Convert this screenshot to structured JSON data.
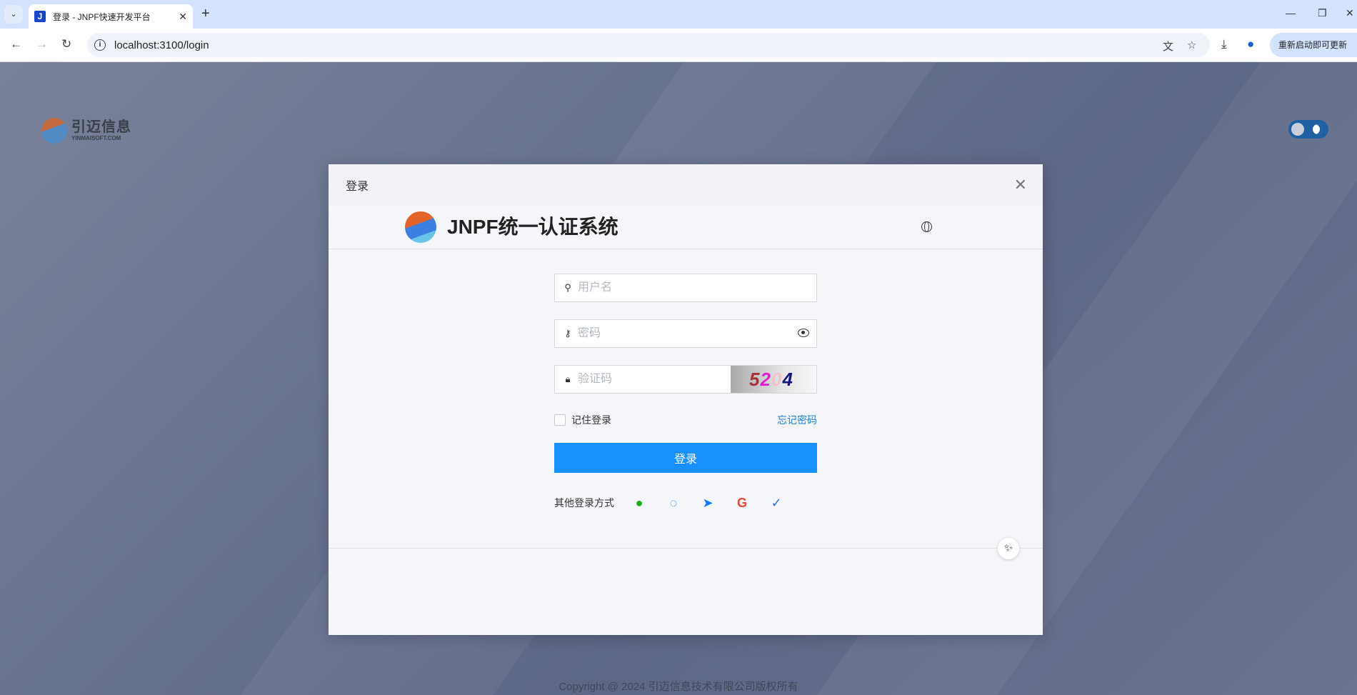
{
  "browser": {
    "tab_title": "登录 - JNPF快速开发平台",
    "favicon": "J",
    "url": "localhost:3100/login",
    "update_label": "重新启动即可更新"
  },
  "brand": {
    "name_cn": "引迈信息",
    "name_en": "YINMAISOFT.COM"
  },
  "modal": {
    "title": "登录",
    "system_title": "JNPF统一认证系统",
    "username_placeholder": "用户名",
    "password_placeholder": "密码",
    "captcha_placeholder": "验证码",
    "captcha_text": "5204",
    "remember_label": "记住登录",
    "forgot_label": "忘记密码",
    "login_label": "登录",
    "other_login_label": "其他登录方式",
    "social": [
      "wechat-icon",
      "qq-icon",
      "dingtalk-icon",
      "google-icon",
      "feishu-icon"
    ]
  },
  "footer": {
    "copyright": "Copyright @ 2024 引迈信息技术有限公司版权所有"
  },
  "colors": {
    "primary": "#1890ff",
    "link": "#1e80d8"
  }
}
